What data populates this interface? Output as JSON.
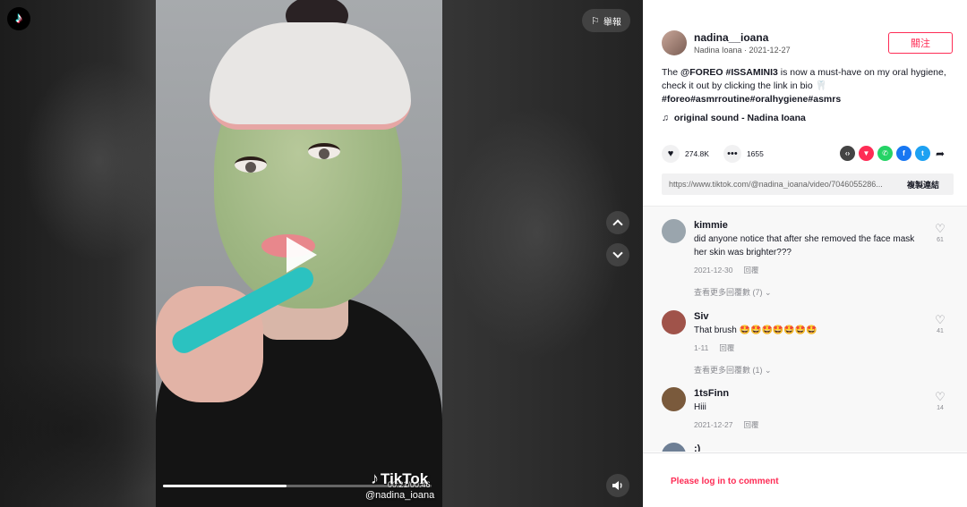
{
  "video": {
    "logo_glyph": "♪",
    "report_label": "舉報",
    "watermark": "TikTok",
    "watermark_user": "@nadina_ioana",
    "time": "00:21/00:46",
    "progress_fraction": 0.46
  },
  "author": {
    "handle": "nadina__ioana",
    "subtitle": "Nadina Ioana · 2021-12-27",
    "follow_label": "關注"
  },
  "description": {
    "prefix": "The ",
    "tag1": "@FOREO #ISSAMINI3",
    "middle": " is now a must-have on my oral hygiene, check it out by clicking the link in bio 🦷",
    "tags": "#foreo#asmrroutine#oralhygiene#asmrs"
  },
  "sound": {
    "label": "original sound - Nadina Ioana"
  },
  "stats": {
    "likes": "274.8K",
    "comments": "1655"
  },
  "share_icons": [
    {
      "name": "embed-icon",
      "glyph": "‹›",
      "color": "#444444"
    },
    {
      "name": "send-icon",
      "glyph": "▼",
      "color": "#fe2c55"
    },
    {
      "name": "whatsapp-icon",
      "glyph": "✆",
      "color": "#25d366"
    },
    {
      "name": "facebook-icon",
      "glyph": "f",
      "color": "#1877f2"
    },
    {
      "name": "twitter-icon",
      "glyph": "t",
      "color": "#1da1f2"
    }
  ],
  "link": {
    "url": "https://www.tiktok.com/@nadina_ioana/video/7046055286...",
    "copy_label": "複製連結"
  },
  "comments": [
    {
      "name": "kimmie",
      "text": "did anyone notice that after she removed the face mask her skin was brighter???",
      "date": "2021-12-30",
      "reply": "回覆",
      "likes": "61",
      "more": "查看更多回覆數 (7)",
      "avatar_color": "#9aa5ad"
    },
    {
      "name": "Siv",
      "text": "That brush 🤩🤩🤩🤩🤩🤩🤩",
      "date": "1-11",
      "reply": "回覆",
      "likes": "41",
      "more": "查看更多回覆數 (1)",
      "avatar_color": "#a0534a"
    },
    {
      "name": "1tsFinn",
      "text": "Hiii",
      "date": "2021-12-27",
      "reply": "回覆",
      "likes": "14",
      "more": "",
      "avatar_color": "#7a5a3c"
    },
    {
      "name": ":)",
      "text": "",
      "date": "",
      "reply": "",
      "likes": "",
      "more": "",
      "avatar_color": "#6e7f95"
    }
  ],
  "login": {
    "label": "Please log in to comment"
  }
}
